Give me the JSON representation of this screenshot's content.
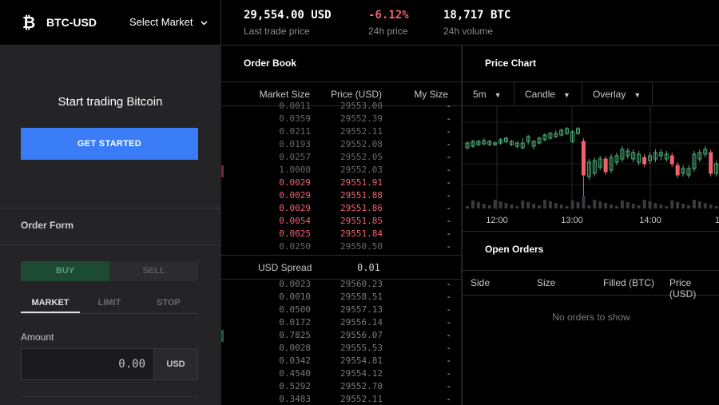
{
  "header": {
    "pair": "BTC-USD",
    "select_market": "Select Market",
    "last_trade_price": "29,554.00 USD",
    "last_trade_label": "Last trade price",
    "change_24h": "-6.12%",
    "change_label": "24h price",
    "volume_24h": "18,717 BTC",
    "volume_label": "24h volume"
  },
  "left": {
    "start_title": "Start trading Bitcoin",
    "get_started": "GET STARTED",
    "order_form_title": "Order Form",
    "buy": "BUY",
    "sell": "SELL",
    "tabs": [
      "MARKET",
      "LIMIT",
      "STOP"
    ],
    "amount_label": "Amount",
    "amount_value": "0.00",
    "amount_unit": "USD"
  },
  "order_book": {
    "title": "Order Book",
    "col_size": "Market Size",
    "col_price": "Price (USD)",
    "col_my": "My Size",
    "asks": [
      {
        "size": "0.0011",
        "price": "29553.00",
        "my": "-",
        "tone": "dim"
      },
      {
        "size": "0.0359",
        "price": "29552.39",
        "my": "-",
        "tone": "dim"
      },
      {
        "size": "0.0211",
        "price": "29552.11",
        "my": "-",
        "tone": "dim"
      },
      {
        "size": "0.0193",
        "price": "29552.08",
        "my": "-",
        "tone": "dim"
      },
      {
        "size": "0.0257",
        "price": "29552.05",
        "my": "-",
        "tone": "dim"
      },
      {
        "size": "1.0000",
        "price": "29552.03",
        "my": "-",
        "tone": "dim"
      },
      {
        "size": "0.0029",
        "price": "29551.91",
        "my": "-",
        "tone": "red"
      },
      {
        "size": "0.0029",
        "price": "29551.88",
        "my": "-",
        "tone": "red"
      },
      {
        "size": "0.0029",
        "price": "29551.86",
        "my": "-",
        "tone": "red"
      },
      {
        "size": "0.0054",
        "price": "29551.85",
        "my": "-",
        "tone": "red"
      },
      {
        "size": "0.0025",
        "price": "29551.84",
        "my": "-",
        "tone": "red"
      },
      {
        "size": "0.0250",
        "price": "29550.50",
        "my": "-",
        "tone": "dim"
      }
    ],
    "spread_label": "USD Spread",
    "spread_value": "0.01",
    "bids": [
      {
        "size": "0.0023",
        "price": "29560.23",
        "my": "-"
      },
      {
        "size": "0.0010",
        "price": "29558.51",
        "my": "-"
      },
      {
        "size": "0.0500",
        "price": "29557.13",
        "my": "-"
      },
      {
        "size": "0.0172",
        "price": "29556.14",
        "my": "-"
      },
      {
        "size": "0.7825",
        "price": "29556.07",
        "my": "-"
      },
      {
        "size": "0.0028",
        "price": "29555.53",
        "my": "-"
      },
      {
        "size": "0.0342",
        "price": "29554.81",
        "my": "-"
      },
      {
        "size": "0.4540",
        "price": "29554.12",
        "my": "-"
      },
      {
        "size": "0.5292",
        "price": "29552.70",
        "my": "-"
      },
      {
        "size": "0.3483",
        "price": "29552.11",
        "my": "-"
      }
    ]
  },
  "price_chart": {
    "title": "Price Chart",
    "interval": "5m",
    "style": "Candle",
    "overlay": "Overlay",
    "time_labels": [
      "12:00",
      "13:00",
      "14:00",
      "1"
    ],
    "colors": {
      "up": "#4fb07a",
      "down": "#f0616d"
    }
  },
  "open_orders": {
    "title": "Open Orders",
    "columns": [
      "Side",
      "Size",
      "Filled (BTC)",
      "Price (USD)"
    ],
    "empty": "No orders to show"
  }
}
